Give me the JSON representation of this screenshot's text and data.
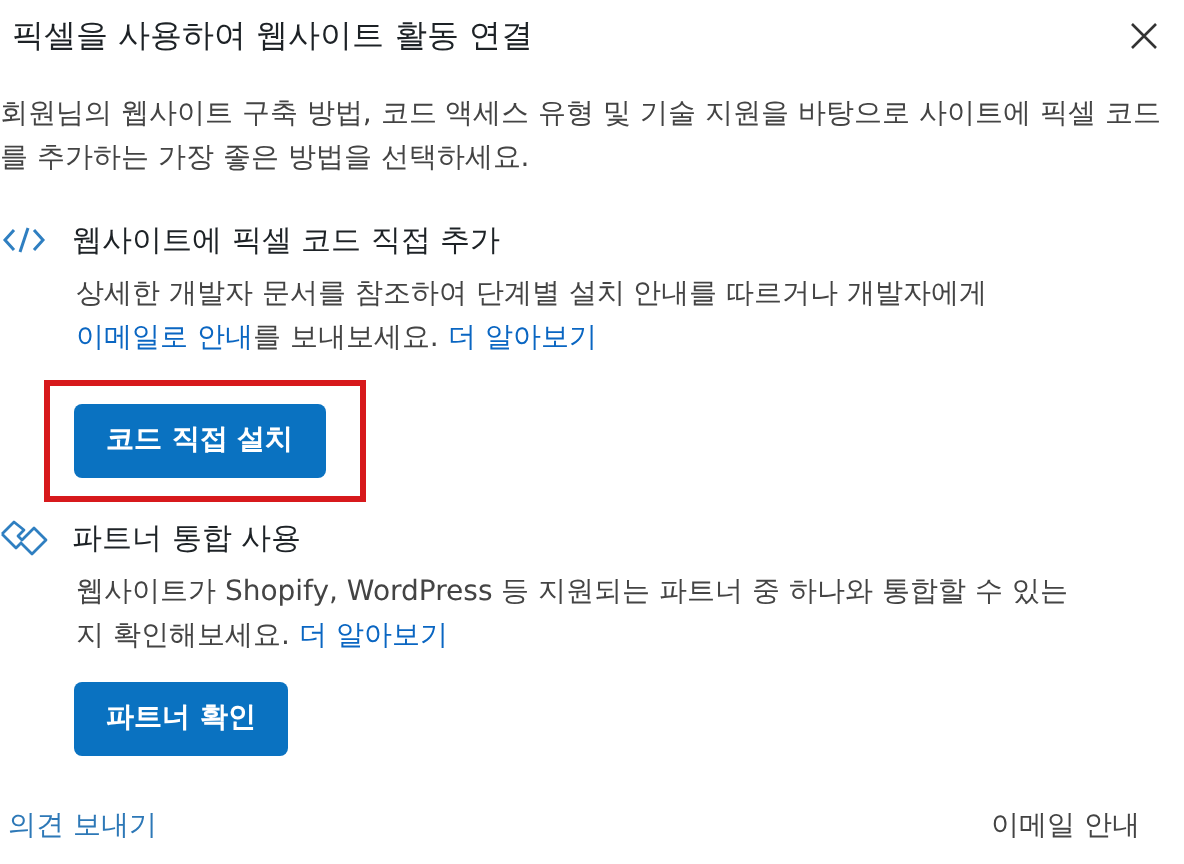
{
  "dialog": {
    "title": "픽셀을 사용하여 웹사이트 활동 연결",
    "intro": "회원님의 웹사이트 구축 방법, 코드 액세스 유형 및 기술 지원을 바탕으로 사이트에 픽셀 코드를 추가하는 가장 좋은 방법을 선택하세요."
  },
  "options": [
    {
      "kind": "code",
      "title": "웹사이트에 픽셀 코드 직접 추가",
      "text": "상세한 개발자 문서를 참조하여 단계별 설치 안내를 따르거나 개발자에게 ",
      "link": "이메일로 안내",
      "text_after": "를 보내보세요. ",
      "learn_more": "더 알아보기",
      "button": "코드 직접 설치",
      "highlighted": true
    },
    {
      "kind": "partner",
      "title": "파트너 통합 사용",
      "text": "웹사이트가 Shopify, WordPress 등 지원되는 파트너 중 하나와 통합할 수 있는지 확인해보세요. ",
      "learn_more": "더 알아보기",
      "button": "파트너 확인",
      "highlighted": false
    }
  ],
  "footer": {
    "left": "의견 보내기",
    "right": "이메일 안내"
  }
}
